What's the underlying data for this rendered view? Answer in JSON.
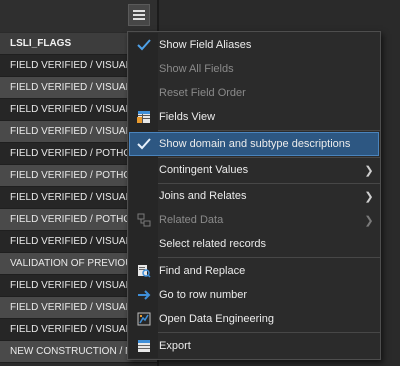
{
  "table": {
    "header": "LSLI_FLAGS",
    "rows": [
      "FIELD VERIFIED / VISUAL",
      "FIELD VERIFIED / VISUAL",
      "FIELD VERIFIED / VISUAL",
      "FIELD VERIFIED / VISUAL",
      "FIELD VERIFIED / POTHO",
      "FIELD VERIFIED / POTHO",
      "FIELD VERIFIED / VISUAL",
      "FIELD VERIFIED / POTHO",
      "FIELD VERIFIED / VISUAL",
      "VALIDATION OF PREVIOU",
      "FIELD VERIFIED / VISUAL",
      "FIELD VERIFIED / VISUAL",
      "FIELD VERIFIED / VISUAL",
      "NEW CONSTRUCTION / M"
    ]
  },
  "menu": {
    "items": [
      {
        "label": "Show Field Aliases",
        "icon": "checkmark-icon",
        "checked": true,
        "enabled": true,
        "submenu": false
      },
      {
        "label": "Show All Fields",
        "icon": "",
        "checked": false,
        "enabled": false,
        "submenu": false
      },
      {
        "label": "Reset Field Order",
        "icon": "",
        "checked": false,
        "enabled": false,
        "submenu": false
      },
      {
        "label": "Fields View",
        "icon": "fields-view-icon",
        "checked": false,
        "enabled": true,
        "submenu": false
      },
      {
        "label": "Show domain and subtype descriptions",
        "icon": "checkmark-icon",
        "checked": true,
        "enabled": true,
        "submenu": false,
        "highlighted": true
      },
      {
        "label": "Contingent Values",
        "icon": "",
        "checked": false,
        "enabled": true,
        "submenu": true
      },
      {
        "label": "Joins and Relates",
        "icon": "",
        "checked": false,
        "enabled": true,
        "submenu": true
      },
      {
        "label": "Related Data",
        "icon": "related-data-icon",
        "checked": false,
        "enabled": false,
        "submenu": true
      },
      {
        "label": "Select related records",
        "icon": "",
        "checked": false,
        "enabled": true,
        "submenu": false
      },
      {
        "label": "Find and Replace",
        "icon": "find-replace-icon",
        "checked": false,
        "enabled": true,
        "submenu": false
      },
      {
        "label": "Go to row number",
        "icon": "arrow-right-icon",
        "checked": false,
        "enabled": true,
        "submenu": false
      },
      {
        "label": "Open Data Engineering",
        "icon": "data-engineering-icon",
        "checked": false,
        "enabled": true,
        "submenu": false
      },
      {
        "label": "Export",
        "icon": "export-icon",
        "checked": false,
        "enabled": true,
        "submenu": false
      }
    ]
  },
  "colors": {
    "highlight": "#2d5782",
    "check": "#4ea1e8",
    "arrow_icon": "#3f8fd8"
  }
}
